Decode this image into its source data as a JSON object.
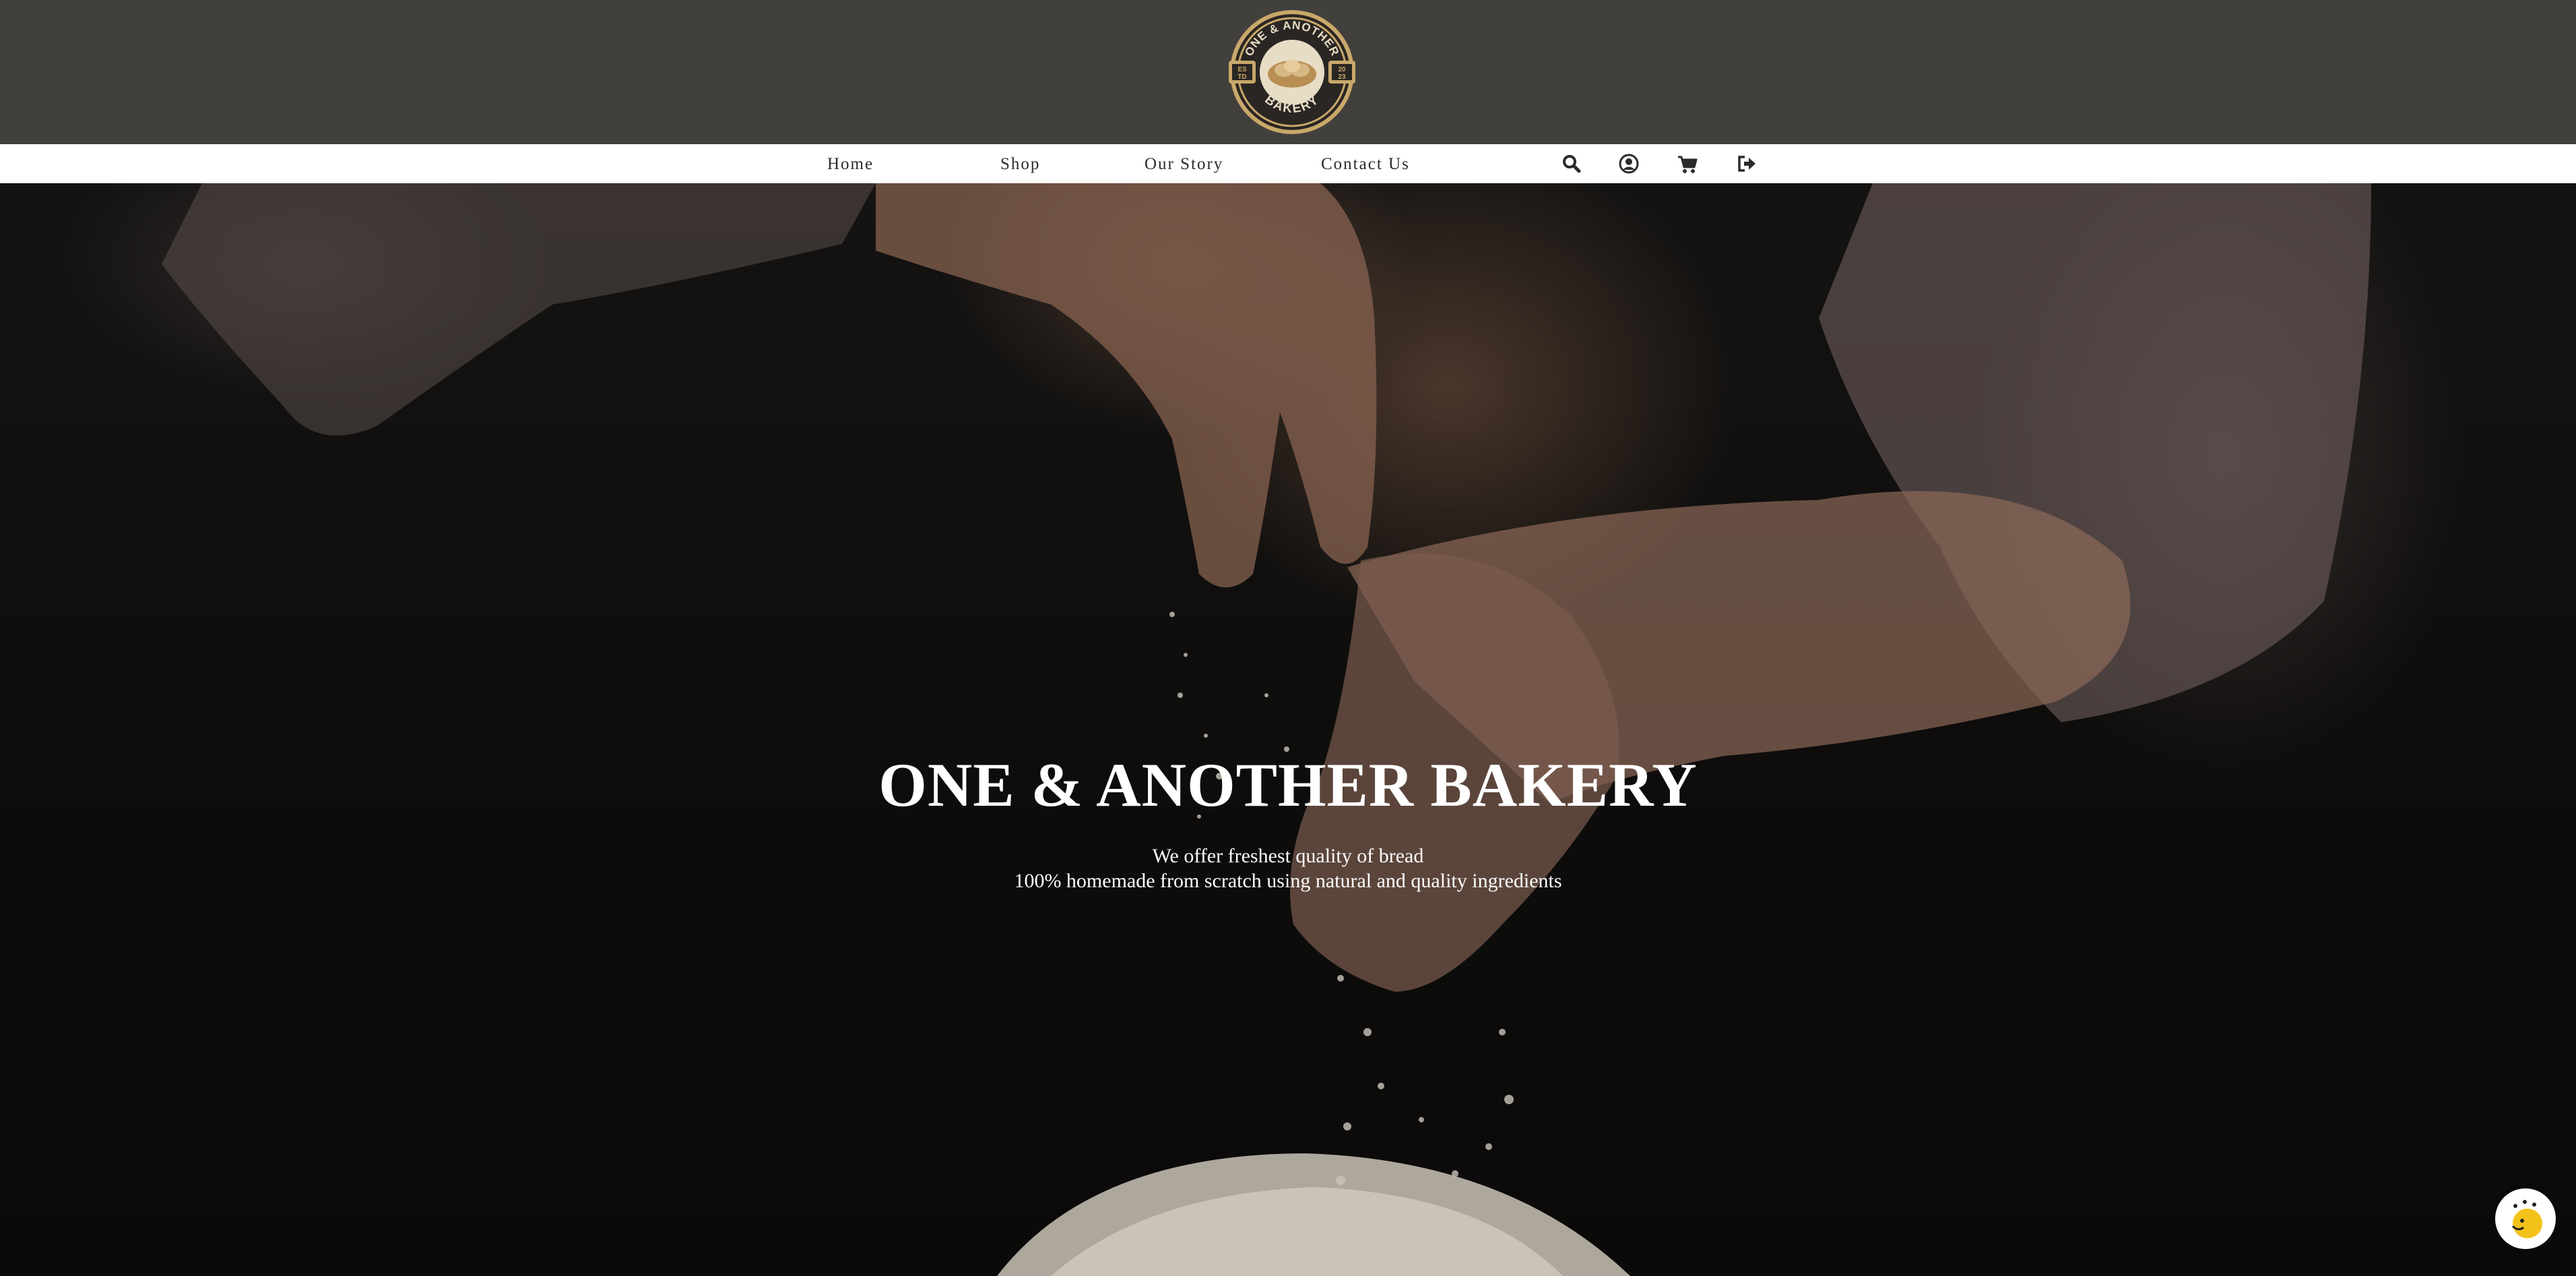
{
  "header": {
    "logo": {
      "name": "bakery-logo",
      "text_top": "ONE & ANOTHER",
      "text_bottom": "BAKERY",
      "est_left": "ES TD",
      "est_right": "20 23"
    }
  },
  "nav": {
    "links": [
      {
        "label": "Home"
      },
      {
        "label": "Shop"
      },
      {
        "label": "Our Story"
      },
      {
        "label": "Contact Us"
      }
    ],
    "icons": [
      "search-icon",
      "user-icon",
      "cart-icon",
      "logout-icon"
    ]
  },
  "hero": {
    "title": "ONE & ANOTHER BAKERY",
    "subtitle_line1": "We offer freshest quality of bread",
    "subtitle_line2": "100% homemade from scratch using natural and quality ingredients"
  },
  "chat_widget": {
    "icon": "chat-avatar-icon"
  },
  "colors": {
    "header_bg": "#42403d",
    "nav_bg": "#ffffff",
    "logo_gold": "#c9a86a",
    "hero_text": "#ffffff"
  }
}
